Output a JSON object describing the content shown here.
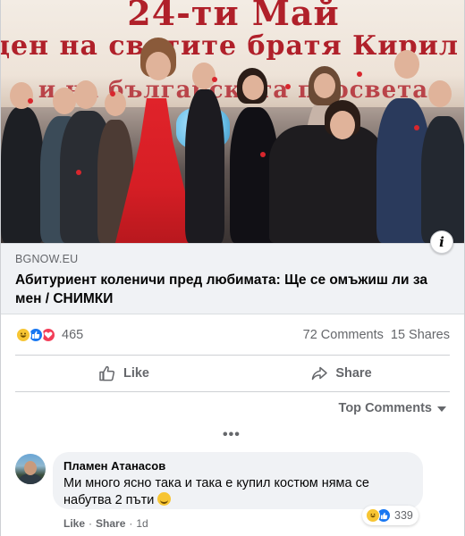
{
  "post": {
    "photo": {
      "banner_line1": "24-ти Май",
      "banner_line2": "ден на светите братя Кирил и Методий",
      "banner_line3": "и на българската просвета"
    },
    "link": {
      "domain": "BGNOW.EU",
      "headline": "Абитуриент коленичи пред любимата: Ще се омъжиш ли за мен / СНИМКИ"
    },
    "reactions": {
      "icons": [
        "haha-icon",
        "like-icon",
        "love-icon"
      ],
      "count": "465",
      "comments": "72 Comments",
      "shares": "15 Shares"
    },
    "actions": {
      "like_label": "Like",
      "share_label": "Share"
    },
    "sort": {
      "label": "Top Comments"
    },
    "more_label": "•••"
  },
  "comment": {
    "author": "Пламен Атанасов",
    "text": "Ми много ясно така и така е купил костюм няма се набутва 2 пъти",
    "emoji": "grinning-face-emoji",
    "reaction_count": "339",
    "meta": {
      "like_label": "Like",
      "share_label": "Share",
      "separator": "·",
      "time": "1d"
    }
  },
  "colors": {
    "accent": "#1877f2",
    "love": "#f33e58",
    "haha": "#f7c533",
    "secondary_text": "#65676b",
    "dress_red": "#d61e25"
  }
}
